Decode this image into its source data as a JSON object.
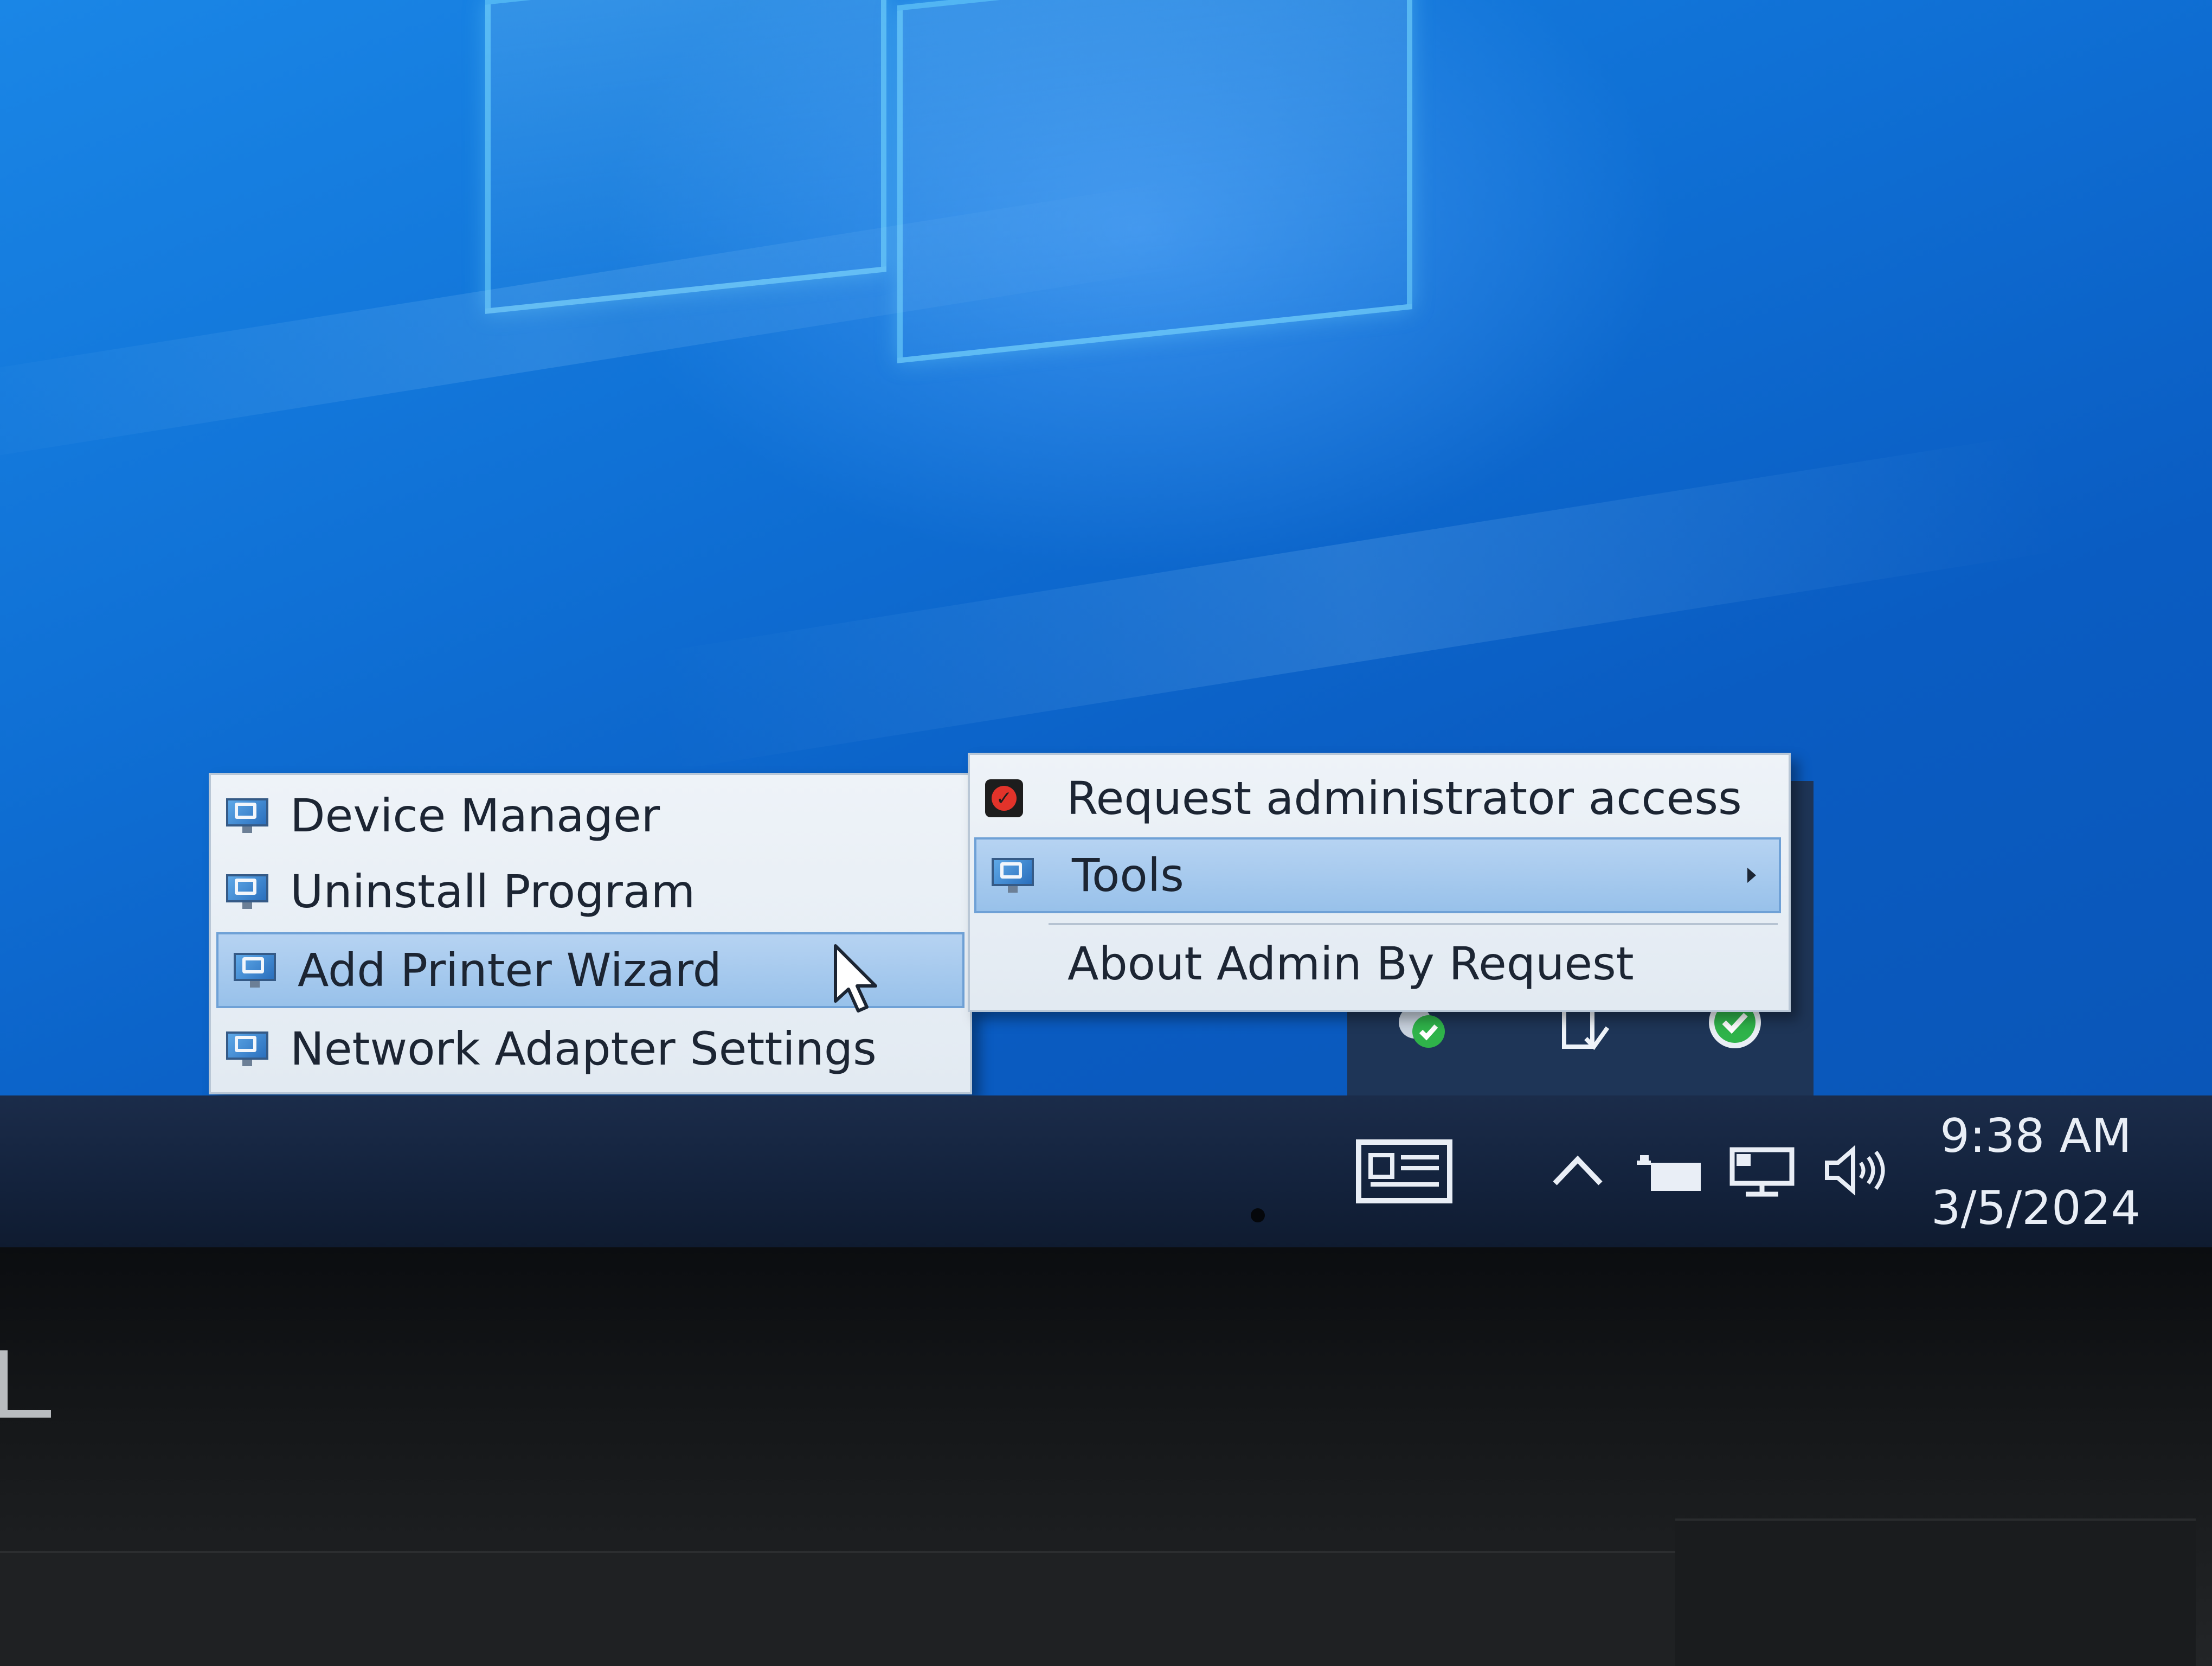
{
  "context_menu": {
    "items": [
      {
        "label": "Device Manager",
        "icon": "computer-management-icon"
      },
      {
        "label": "Uninstall Program",
        "icon": "computer-management-icon"
      },
      {
        "label": "Add Printer Wizard",
        "icon": "computer-management-icon",
        "highlighted": true
      },
      {
        "label": "Network Adapter Settings",
        "icon": "computer-management-icon"
      }
    ]
  },
  "tray_menu": {
    "items": [
      {
        "label": "Request administrator access",
        "icon": "admin-by-request-icon"
      },
      {
        "label": "Tools",
        "icon": "computer-management-icon",
        "highlighted": true,
        "has_submenu": true
      },
      {
        "label": "About Admin By Request"
      }
    ]
  },
  "taskbar": {
    "clock": {
      "time": "9:38 AM",
      "date": "3/5/2024"
    },
    "tray_icons": [
      "news-widget-icon",
      "chevron-up-icon",
      "power-plug-icon",
      "network-icon",
      "volume-icon"
    ],
    "overflow_icons": [
      "defender-check-icon",
      "usb-device-icon",
      "sync-check-icon"
    ]
  },
  "colors": {
    "desktop_blue": "#0f6fd4",
    "taskbar": "#16253f",
    "menu_background": "#e8eef5",
    "menu_highlight": "#a8cbef",
    "check_green": "#2fb34a"
  }
}
